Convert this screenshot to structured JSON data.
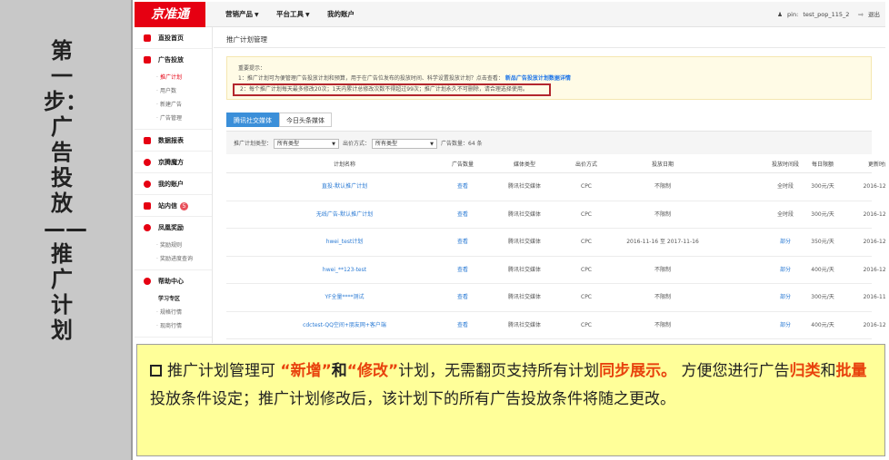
{
  "left_panel": {
    "title": "第一步：广告投放——推广计划"
  },
  "topbar": {
    "logo": "京准通",
    "nav": [
      {
        "label": "营销产品",
        "caret": "▼"
      },
      {
        "label": "平台工具",
        "caret": "▼"
      },
      {
        "label": "我的账户",
        "caret": ""
      }
    ],
    "user_prefix": "pin:",
    "user_name": "test_pop_115_2",
    "logout": "退出"
  },
  "sidebar": {
    "items": [
      {
        "label": "直投首页"
      },
      {
        "label": "广告投放",
        "subs": [
          "推广计划",
          "用户数",
          "新建广告",
          "广告管理"
        ]
      },
      {
        "label": "数据报表"
      },
      {
        "label": "京腾魔方"
      },
      {
        "label": "我的账户"
      },
      {
        "label": "站内信",
        "badge": "5"
      },
      {
        "label": "凤凰奖励",
        "subs": [
          "奖励规则",
          "奖励进度查询"
        ]
      },
      {
        "label": "帮助中心",
        "subs_title": "学习专区",
        "subs": [
          "规格行情",
          "现商行情"
        ]
      }
    ]
  },
  "main": {
    "page_title": "推广计划管理",
    "notice": {
      "heading": "重要提示：",
      "line1": "1：推广计划可为便管理广告投放计划和预算，用于在广告位发布的投放时间、科学设置投放计划？点击查看：",
      "line1_link": "新品广告投放计划数据详情",
      "line2": "2：每个推广计划每天最多修改20次；1天内累计总修改次数不得超过99次；推广计划永久不可删除，请合理选择使用。"
    },
    "tabs": [
      "腾讯社交媒体",
      "今日头条媒体"
    ],
    "filters": {
      "type_label": "推广计划类型：",
      "type_value": "所有类型",
      "method_label": "出价方式：",
      "method_value": "所有类型",
      "count_label": "广告数量：",
      "count_value": "64 条"
    },
    "table": {
      "headers": [
        "计划名称",
        "广告数量",
        "媒体类型",
        "出价方式",
        "投放日期",
        "投放时间段",
        "每日限额",
        "更新时间"
      ],
      "rows": [
        [
          "直投-默认推广计划",
          "查看",
          "腾讯社交媒体",
          "CPC",
          "不限制",
          "全时段",
          "300元/天",
          "2016-12-20"
        ],
        [
          "无线广告-默认推广计划",
          "查看",
          "腾讯社交媒体",
          "CPC",
          "不限制",
          "全时段",
          "300元/天",
          "2016-12-20"
        ],
        [
          "hwei_test计划",
          "查看",
          "腾讯社交媒体",
          "CPC",
          "2016-11-16 至 2017-11-16",
          "部分",
          "350元/天",
          "2016-12-20"
        ],
        [
          "hwei_**123-test",
          "查看",
          "腾讯社交媒体",
          "CPC",
          "不限制",
          "部分",
          "400元/天",
          "2016-12-08"
        ],
        [
          "YF全量****测试",
          "查看",
          "腾讯社交媒体",
          "CPC",
          "不限制",
          "部分",
          "300元/天",
          "2016-11-16"
        ],
        [
          "cdctest-QQ空间+朋友网+客户端",
          "查看",
          "腾讯社交媒体",
          "CPC",
          "不限制",
          "部分",
          "400元/天",
          "2016-12-12"
        ]
      ]
    }
  },
  "note": {
    "p1": "推广计划管理可",
    "h1": "“新增”",
    "p2": "和",
    "h2": "“修改”",
    "p3": "计划，无需翻页支持所有计划",
    "h3": "同步展示。",
    "p4": "方便您进行广告",
    "h4": "归类",
    "p5": "和",
    "h5": "批量",
    "p6": "投放条件设定；推广计划修改后，该计划下的所有广告投放条件将随之更改。"
  },
  "colors": {
    "brand": "#e60012",
    "tab_active": "#3b8fd9",
    "highlight": "#e8420d",
    "note_bg": "#ffff99"
  }
}
